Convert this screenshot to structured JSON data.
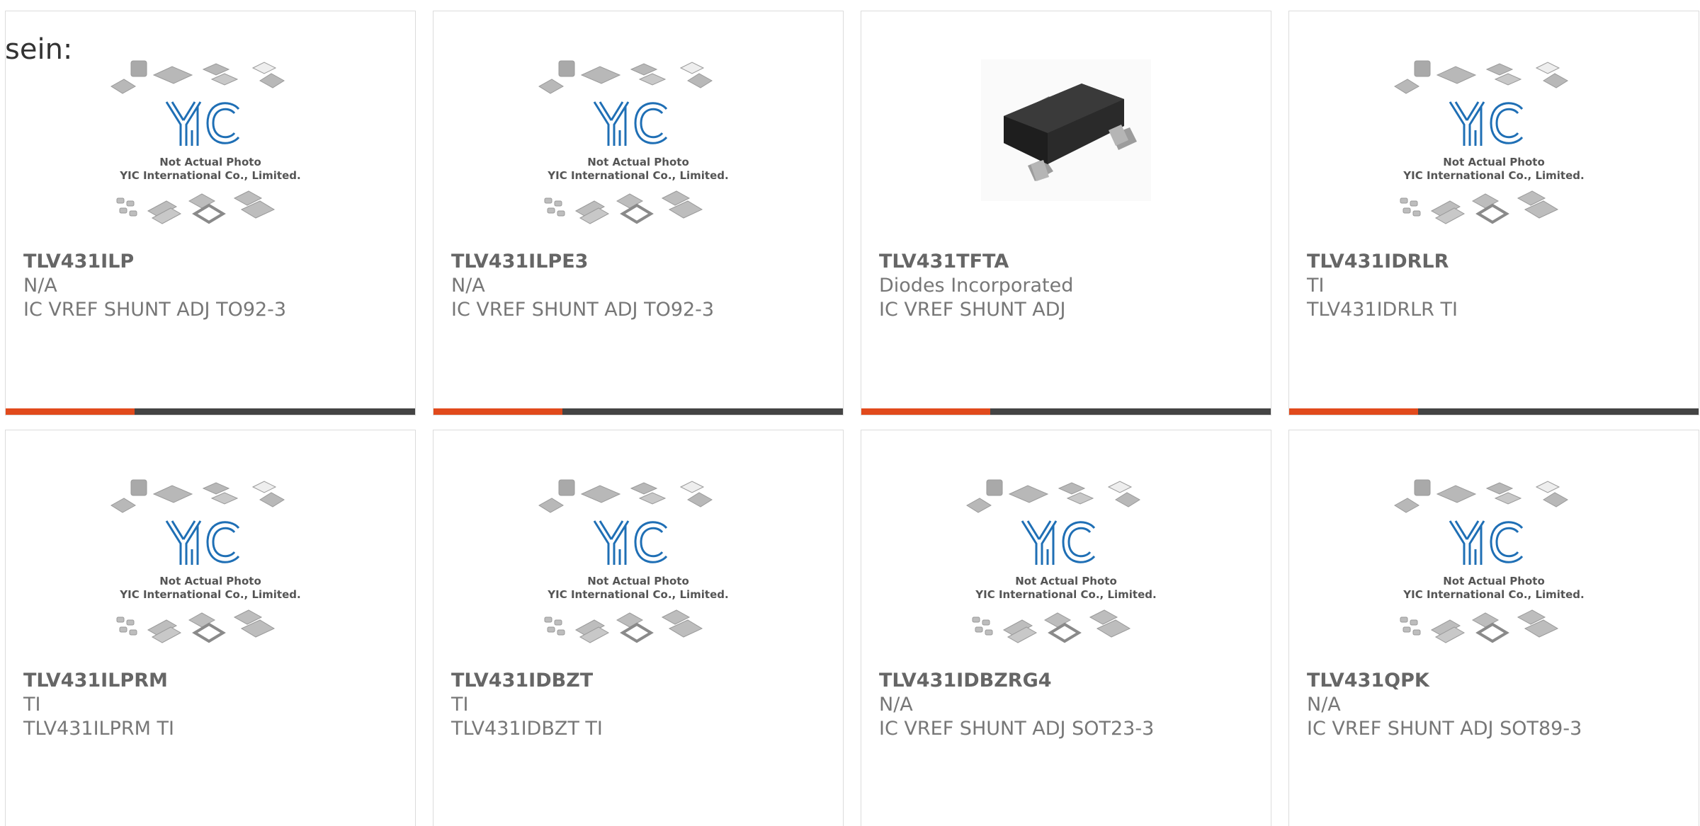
{
  "prefix_text": "sein:",
  "placeholder_caption": {
    "line1": "Not Actual Photo",
    "line2": "YIC International Co., Limited."
  },
  "products": [
    {
      "part_number": "TLV431ILP",
      "manufacturer": "N/A",
      "description": "IC VREF SHUNT ADJ TO92-3",
      "image": "yic-placeholder",
      "show_bar": true
    },
    {
      "part_number": "TLV431ILPE3",
      "manufacturer": "N/A",
      "description": "IC VREF SHUNT ADJ TO92-3",
      "image": "yic-placeholder",
      "show_bar": true
    },
    {
      "part_number": "TLV431TFTA",
      "manufacturer": "Diodes Incorporated",
      "description": "IC VREF SHUNT ADJ",
      "image": "sot23-chip-photo",
      "show_bar": true
    },
    {
      "part_number": "TLV431IDRLR",
      "manufacturer": "TI",
      "description": "TLV431IDRLR TI",
      "image": "yic-placeholder",
      "show_bar": true
    },
    {
      "part_number": "TLV431ILPRM",
      "manufacturer": "TI",
      "description": "TLV431ILPRM TI",
      "image": "yic-placeholder",
      "show_bar": false
    },
    {
      "part_number": "TLV431IDBZT",
      "manufacturer": "TI",
      "description": "TLV431IDBZT TI",
      "image": "yic-placeholder",
      "show_bar": false
    },
    {
      "part_number": "TLV431IDBZRG4",
      "manufacturer": "N/A",
      "description": "IC VREF SHUNT ADJ SOT23-3",
      "image": "yic-placeholder",
      "show_bar": false
    },
    {
      "part_number": "TLV431QPK",
      "manufacturer": "N/A",
      "description": "IC VREF SHUNT ADJ SOT89-3",
      "image": "yic-placeholder",
      "show_bar": false
    }
  ],
  "colors": {
    "accent_bar": "#e14a1c",
    "dark_bar": "#444444",
    "logo_blue": "#1f6fb5",
    "chip_gray": "#b3b3b3"
  }
}
